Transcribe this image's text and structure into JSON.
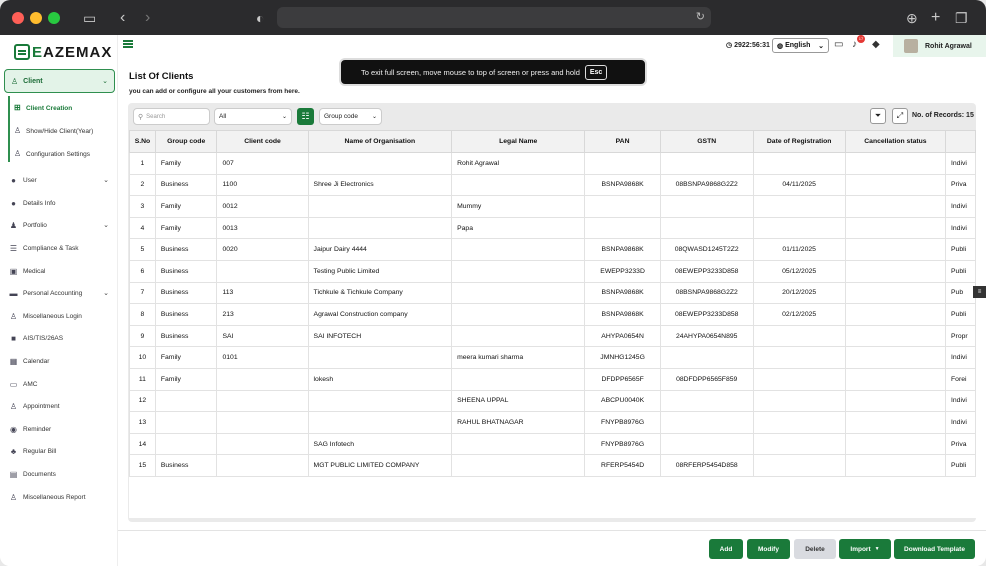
{
  "app": {
    "logo_text": "EAZEMAX"
  },
  "colors": {
    "accent": "#1a7a3a",
    "accent_light": "#e3f3e8",
    "notification": "#e53935"
  },
  "sidebar": {
    "client": {
      "label": "Client",
      "icon": "user-lock-icon"
    },
    "client_sub": [
      {
        "label": "Client Creation",
        "icon": "sitemap-icon"
      },
      {
        "label": "Show/Hide Client(Year)",
        "icon": "user-edit-icon"
      },
      {
        "label": "Configuration Settings",
        "icon": "user-cog-icon"
      }
    ],
    "items": [
      {
        "label": "User",
        "icon": "user-icon",
        "has_chevron": true
      },
      {
        "label": "Details Info",
        "icon": "info-icon",
        "has_chevron": false
      },
      {
        "label": "Portfolio",
        "icon": "portfolio-icon",
        "has_chevron": true
      },
      {
        "label": "Compliance & Task",
        "icon": "list-icon",
        "has_chevron": false
      },
      {
        "label": "Medical",
        "icon": "medical-icon",
        "has_chevron": false
      },
      {
        "label": "Personal Accounting",
        "icon": "accounting-icon",
        "has_chevron": true
      },
      {
        "label": "Miscellaneous Login",
        "icon": "login-icon",
        "has_chevron": false
      },
      {
        "label": "AIS/TIS/26AS",
        "icon": "document-icon",
        "has_chevron": false
      },
      {
        "label": "Calendar",
        "icon": "calendar-icon",
        "has_chevron": false
      },
      {
        "label": "AMC",
        "icon": "amc-icon",
        "has_chevron": false
      },
      {
        "label": "Appointment",
        "icon": "appointment-icon",
        "has_chevron": false
      },
      {
        "label": "Reminder",
        "icon": "reminder-icon",
        "has_chevron": false
      },
      {
        "label": "Regular Bill",
        "icon": "bill-icon",
        "has_chevron": false
      },
      {
        "label": "Documents",
        "icon": "documents-icon",
        "has_chevron": false
      },
      {
        "label": "Miscellaneous Report",
        "icon": "report-icon",
        "has_chevron": false
      }
    ]
  },
  "topbar": {
    "timer": "2922:56:31",
    "language": "English",
    "notification_count": "17",
    "user_name": "Rohit Agrawal"
  },
  "overlay": {
    "message": "To exit full screen, move mouse to top of screen or press and hold",
    "key": "Esc"
  },
  "page": {
    "title": "List Of Clients",
    "subtitle": "you can add or configure all your customers from here."
  },
  "toolbar": {
    "search_placeholder": "Search",
    "filter_value": "All",
    "group_select": "Group code",
    "records_label": "No. of Records: 15"
  },
  "table": {
    "columns": [
      "S.No",
      "Group code",
      "Client code",
      "Name of Organisation",
      "Legal Name",
      "PAN",
      "GSTN",
      "Date of Registration",
      "Cancellation status",
      ""
    ],
    "rows": [
      [
        "1",
        "Family",
        "007",
        "",
        "Rohit Agrawal",
        "",
        "",
        "",
        "",
        "Indivi"
      ],
      [
        "2",
        "Business",
        "1100",
        "Shree Ji Electronics",
        "",
        "BSNPA9868K",
        "08BSNPA9868G2Z2",
        "04/11/2025",
        "",
        "Priva"
      ],
      [
        "3",
        "Family",
        "0012",
        "",
        "Mummy",
        "",
        "",
        "",
        "",
        "Indivi"
      ],
      [
        "4",
        "Family",
        "0013",
        "",
        "Papa",
        "",
        "",
        "",
        "",
        "Indivi"
      ],
      [
        "5",
        "Business",
        "0020",
        "Jaipur Dairy 4444",
        "",
        "BSNPA9868K",
        "08QWASD1245T2Z2",
        "01/11/2025",
        "",
        "Publi"
      ],
      [
        "6",
        "Business",
        "",
        "Testing Public Limited",
        "",
        "EWEPP3233D",
        "08EWEPP3233D858",
        "05/12/2025",
        "",
        "Publi"
      ],
      [
        "7",
        "Business",
        "113",
        "Tichkule & Tichkule Company",
        "",
        "BSNPA9868K",
        "08BSNPA9868G2Z2",
        "20/12/2025",
        "",
        "Pub"
      ],
      [
        "8",
        "Business",
        "213",
        "Agrawal Construction company",
        "",
        "BSNPA9868K",
        "08EWEPP3233D858",
        "02/12/2025",
        "",
        "Publi"
      ],
      [
        "9",
        "Business",
        "SAI",
        "SAI INFOTECH",
        "",
        "AHYPA0654N",
        "24AHYPA0654N895",
        "",
        "",
        "Propr"
      ],
      [
        "10",
        "Family",
        "0101",
        "",
        "meera kumari sharma",
        "JMNHG1245G",
        "",
        "",
        "",
        "Indivi"
      ],
      [
        "11",
        "Family",
        "",
        "lokesh",
        "",
        "DFDPP6565F",
        "08DFDPP6565F859",
        "",
        "",
        "Forei"
      ],
      [
        "12",
        "",
        "",
        "",
        "SHEENA UPPAL",
        "ABCPU0040K",
        "",
        "",
        "",
        "Indivi"
      ],
      [
        "13",
        "",
        "",
        "",
        "RAHUL BHATNAGAR",
        "FNYPB8976G",
        "",
        "",
        "",
        "Indivi"
      ],
      [
        "14",
        "",
        "",
        "SAG Infotech",
        "",
        "FNYPB8976G",
        "",
        "",
        "",
        "Priva"
      ],
      [
        "15",
        "Business",
        "",
        "MGT PUBLIC LIMITED COMPANY",
        "",
        "RFERP5454D",
        "08RFERP5454D858",
        "",
        "",
        "Publi"
      ]
    ]
  },
  "footer": {
    "add": "Add",
    "modify": "Modify",
    "delete": "Delete",
    "import": "Import",
    "download": "Download Template"
  }
}
